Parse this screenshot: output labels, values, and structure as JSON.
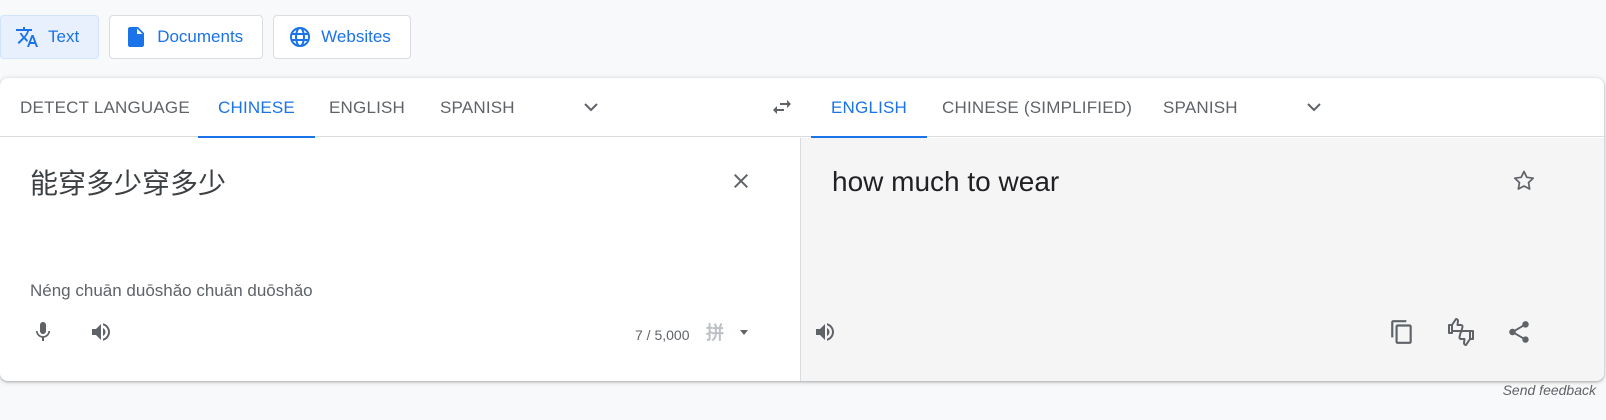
{
  "mode_tabs": [
    {
      "label": "Text",
      "icon": "translate-icon",
      "active": true
    },
    {
      "label": "Documents",
      "icon": "document-icon",
      "active": false
    },
    {
      "label": "Websites",
      "icon": "globe-icon",
      "active": false
    }
  ],
  "source": {
    "languages": [
      "DETECT LANGUAGE",
      "CHINESE",
      "ENGLISH",
      "SPANISH"
    ],
    "active_language": "CHINESE",
    "text": "能穿多少穿多少",
    "romanization": "Néng chuān duōshǎo chuān duōshǎo",
    "char_count": "7 / 5,000",
    "input_tool_glyph": "拼"
  },
  "target": {
    "languages": [
      "ENGLISH",
      "CHINESE (SIMPLIFIED)",
      "SPANISH"
    ],
    "active_language": "ENGLISH",
    "text": "how much to wear"
  },
  "footer": {
    "feedback": "Send feedback"
  },
  "colors": {
    "accent": "#1a73e8",
    "icon_gray": "#5f6368",
    "target_bg": "#f5f5f5"
  }
}
